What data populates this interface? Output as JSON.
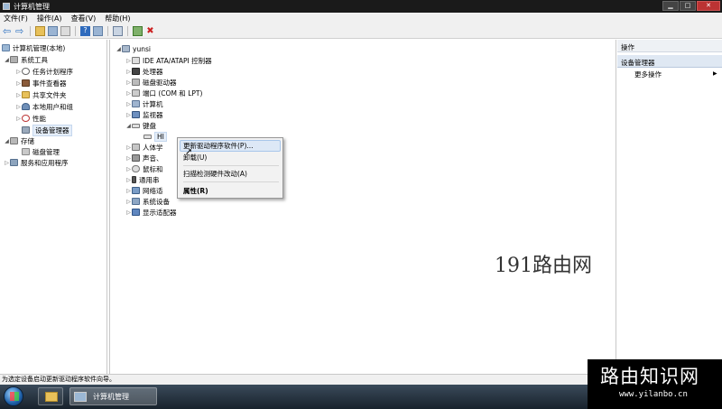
{
  "window": {
    "title": "计算机管理"
  },
  "menu": [
    "文件(F)",
    "操作(A)",
    "查看(V)",
    "帮助(H)"
  ],
  "left_tree": {
    "root": "计算机管理(本地)",
    "system_tools": "系统工具",
    "items": [
      "任务计划程序",
      "事件查看器",
      "共享文件夹",
      "本地用户和组",
      "性能",
      "设备管理器"
    ],
    "storage": "存储",
    "storage_items": [
      "磁盘管理"
    ],
    "services": "服务和应用程序"
  },
  "device_tree": {
    "computer": "yunsi",
    "before": [
      "IDE ATA/ATAPI 控制器",
      "处理器",
      "磁盘驱动器",
      "端口 (COM 和 LPT)",
      "计算机",
      "监视器"
    ],
    "keyboard": "键盘",
    "keyboard_child": "HI",
    "after": [
      "人体学",
      "声音、",
      "鼠标和",
      "通用串",
      "网络适",
      "系统设备",
      "显示适配器"
    ]
  },
  "context_menu": {
    "update": "更新驱动程序软件(P)...",
    "uninstall": "卸载(U)",
    "scan": "扫描检测硬件改动(A)",
    "properties": "属性(R)"
  },
  "actions_pane": {
    "header": "操作",
    "section": "设备管理器",
    "more": "更多操作"
  },
  "watermark_text": "191路由网",
  "status_text": "为选定设备启动更新驱动程序软件向导。",
  "taskbar": {
    "app_label": "计算机管理"
  },
  "corner_watermark": {
    "title": "路由知识网",
    "url": "www.yilanbo.cn"
  }
}
